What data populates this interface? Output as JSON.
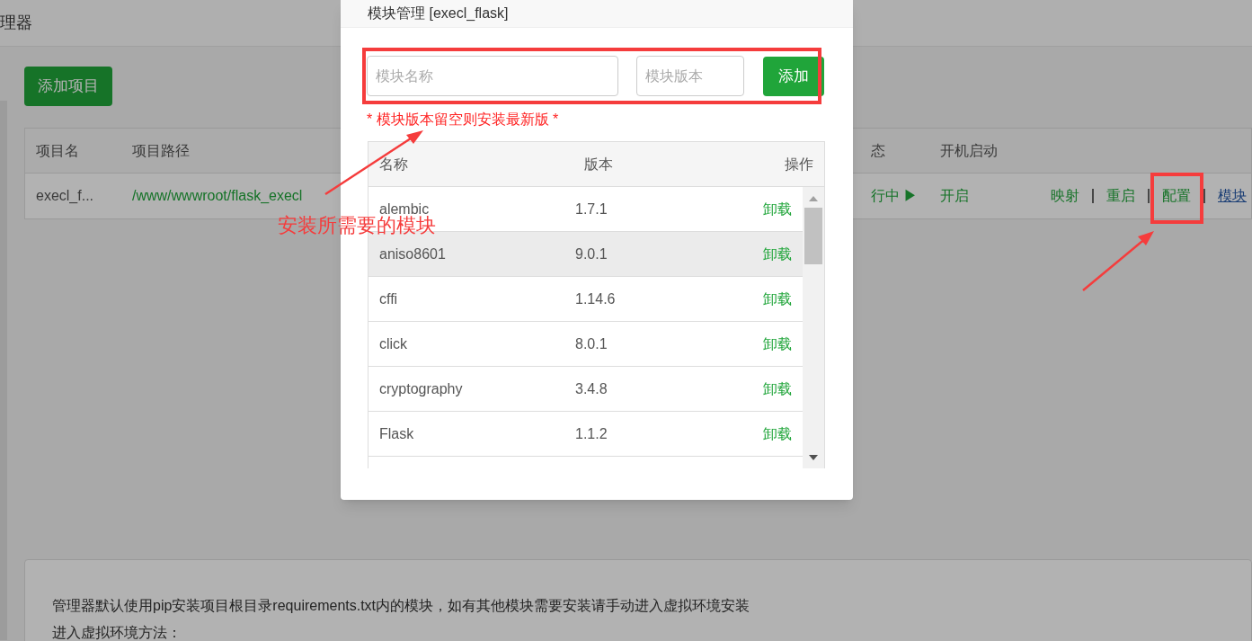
{
  "page": {
    "title": "理器",
    "add_project_button": "添加项目",
    "table": {
      "columns": [
        "项目名",
        "项目路径",
        "态",
        "开机启动"
      ],
      "rows": [
        {
          "name": "execl_f...",
          "path": "/www/wwwroot/flask_execl",
          "status": "行中 ▶",
          "autostart": "开启",
          "actions": [
            {
              "label": "映射",
              "kind": "plain"
            },
            {
              "label": "重启",
              "kind": "plain"
            },
            {
              "label": "配置",
              "kind": "plain"
            },
            {
              "label": "模块",
              "kind": "link"
            }
          ]
        }
      ]
    },
    "notes": [
      "管理器默认使用pip安装项目根目录requirements.txt内的模块，如有其他模块需要安装请手动进入虚拟环境安装",
      "进入虚拟环境方法："
    ]
  },
  "modal": {
    "title": "模块管理 [execl_flask]",
    "name_field": {
      "placeholder": "模块名称"
    },
    "version_field": {
      "placeholder": "模块版本"
    },
    "add_button": "添加",
    "hint": "* 模块版本留空则安装最新版 *",
    "columns": [
      "名称",
      "版本",
      "操作"
    ],
    "rows": [
      {
        "name": "alembic",
        "version": "1.7.1",
        "action": "卸载",
        "hovered": false
      },
      {
        "name": "aniso8601",
        "version": "9.0.1",
        "action": "卸载",
        "hovered": true
      },
      {
        "name": "cffi",
        "version": "1.14.6",
        "action": "卸载",
        "hovered": false
      },
      {
        "name": "click",
        "version": "8.0.1",
        "action": "卸载",
        "hovered": false
      },
      {
        "name": "cryptography",
        "version": "3.4.8",
        "action": "卸载",
        "hovered": false
      },
      {
        "name": "Flask",
        "version": "1.1.2",
        "action": "卸载",
        "hovered": false
      }
    ]
  },
  "annotation": {
    "label": "安装所需要的模块"
  }
}
